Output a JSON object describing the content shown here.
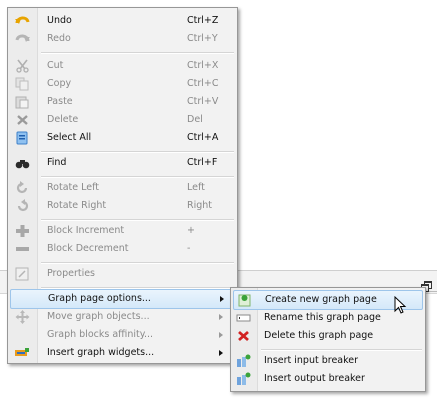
{
  "context_menu": {
    "undo": {
      "label": "Undo",
      "shortcut": "Ctrl+Z",
      "icon": "undo-icon"
    },
    "redo": {
      "label": "Redo",
      "shortcut": "Ctrl+Y",
      "icon": "redo-icon"
    },
    "cut": {
      "label": "Cut",
      "shortcut": "Ctrl+X",
      "icon": "scissors-icon"
    },
    "copy": {
      "label": "Copy",
      "shortcut": "Ctrl+C",
      "icon": "copy-icon"
    },
    "paste": {
      "label": "Paste",
      "shortcut": "Ctrl+V",
      "icon": "paste-icon"
    },
    "delete": {
      "label": "Delete",
      "shortcut": "Del",
      "icon": "delete-icon"
    },
    "select_all": {
      "label": "Select All",
      "shortcut": "Ctrl+A",
      "icon": "select-all-icon"
    },
    "find": {
      "label": "Find",
      "shortcut": "Ctrl+F",
      "icon": "binoculars-icon"
    },
    "rotate_left": {
      "label": "Rotate Left",
      "shortcut": "Left",
      "icon": "rotate-left-icon"
    },
    "rotate_right": {
      "label": "Rotate Right",
      "shortcut": "Right",
      "icon": "rotate-right-icon"
    },
    "block_increment": {
      "label": "Block Increment",
      "shortcut": "+",
      "icon": "plus-icon"
    },
    "block_decrement": {
      "label": "Block Decrement",
      "shortcut": "-",
      "icon": "minus-icon"
    },
    "properties": {
      "label": "Properties",
      "icon": "properties-icon"
    },
    "graph_page_options": {
      "label": "Graph page options...",
      "icon": ""
    },
    "move_graph_objects": {
      "label": "Move graph objects...",
      "icon": "move-icon"
    },
    "graph_blocks_affinity": {
      "label": "Graph blocks affinity...",
      "icon": ""
    },
    "insert_graph_widgets": {
      "label": "Insert graph widgets...",
      "icon": "widgets-icon"
    }
  },
  "submenu": {
    "create_new_graph_page": {
      "label": "Create new graph page",
      "icon": "new-page-icon"
    },
    "rename_graph_page": {
      "label": "Rename this graph page",
      "icon": "rename-icon"
    },
    "delete_graph_page": {
      "label": "Delete this graph page",
      "icon": "red-x-icon"
    },
    "insert_input_breaker": {
      "label": "Insert input breaker",
      "icon": "input-breaker-icon"
    },
    "insert_output_breaker": {
      "label": "Insert output breaker",
      "icon": "output-breaker-icon"
    }
  },
  "colors": {
    "menu_bg": "#f2f2f2",
    "highlight": "#d4e8f9",
    "highlight_border": "#9ec5ea",
    "disabled_text": "#8a8a8a",
    "delete_red": "#d22222"
  }
}
